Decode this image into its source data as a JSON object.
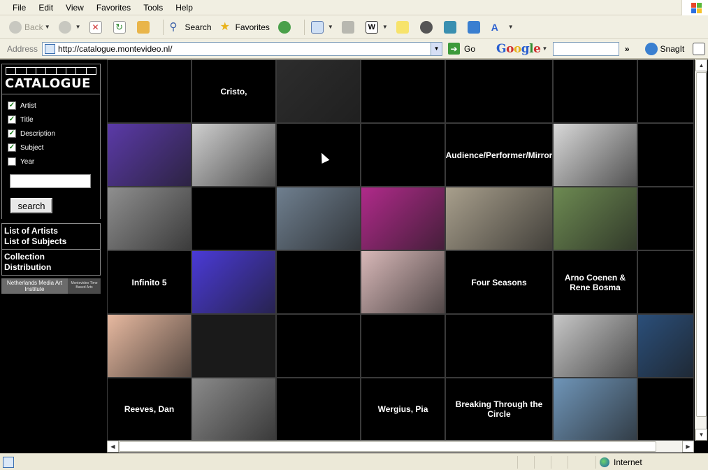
{
  "menu": [
    "File",
    "Edit",
    "View",
    "Favorites",
    "Tools",
    "Help"
  ],
  "toolbar": {
    "back_label": "Back",
    "search_label": "Search",
    "favorites_label": "Favorites"
  },
  "address": {
    "label": "Address",
    "url": "http://catalogue.montevideo.nl/",
    "go_label": "Go"
  },
  "google": {
    "logo": "Google",
    "snagit_label": "SnagIt"
  },
  "sidebar": {
    "logo_text": "CATALOGUE",
    "filters": [
      {
        "label": "Artist",
        "checked": true
      },
      {
        "label": "Title",
        "checked": true
      },
      {
        "label": "Description",
        "checked": true
      },
      {
        "label": "Subject",
        "checked": true
      },
      {
        "label": "Year",
        "checked": false
      }
    ],
    "search_button": "search",
    "links1": [
      "List of Artists",
      "List of Subjects"
    ],
    "links2": [
      "Collection",
      "Distribution"
    ],
    "partner1": "Netherlands Media Art Institute",
    "partner2": "Montevideo Time Based Arts"
  },
  "grid": {
    "cells": [
      {
        "row": 0,
        "col": 0,
        "text": "",
        "color": "#000000"
      },
      {
        "row": 0,
        "col": 1,
        "text": "Cristo,",
        "color": "#000000"
      },
      {
        "row": 0,
        "col": 2,
        "text": "",
        "color": "#2d2d2d",
        "image": true
      },
      {
        "row": 0,
        "col": 3,
        "text": "",
        "color": "#000000"
      },
      {
        "row": 0,
        "col": 4,
        "text": "",
        "color": "#000000"
      },
      {
        "row": 0,
        "col": 5,
        "text": "",
        "color": "#000000"
      },
      {
        "row": 0,
        "col": 6,
        "text": "",
        "color": "#000000"
      },
      {
        "row": 1,
        "col": 0,
        "text": "",
        "color": "#5b3aa8",
        "image": true
      },
      {
        "row": 1,
        "col": 1,
        "text": "",
        "color": "#cfcfcf",
        "image": true
      },
      {
        "row": 1,
        "col": 2,
        "text": "",
        "color": "#000000"
      },
      {
        "row": 1,
        "col": 3,
        "text": "",
        "color": "#000000"
      },
      {
        "row": 1,
        "col": 4,
        "text": "Audience/Performer/Mirror",
        "color": "#000000"
      },
      {
        "row": 1,
        "col": 5,
        "text": "",
        "color": "#d9d9d9",
        "image": true
      },
      {
        "row": 1,
        "col": 6,
        "text": "",
        "color": "#000000"
      },
      {
        "row": 2,
        "col": 0,
        "text": "",
        "color": "#8f8f8f",
        "image": true
      },
      {
        "row": 2,
        "col": 1,
        "text": "",
        "color": "#000000"
      },
      {
        "row": 2,
        "col": 2,
        "text": "",
        "color": "#6f7f8f",
        "image": true
      },
      {
        "row": 2,
        "col": 3,
        "text": "",
        "color": "#b02a8a",
        "image": true
      },
      {
        "row": 2,
        "col": 4,
        "text": "",
        "color": "#a89f8c",
        "image": true
      },
      {
        "row": 2,
        "col": 5,
        "text": "",
        "color": "#6d8a52",
        "image": true
      },
      {
        "row": 2,
        "col": 6,
        "text": "",
        "color": "#000000"
      },
      {
        "row": 3,
        "col": 0,
        "text": "Infinito 5",
        "color": "#000000"
      },
      {
        "row": 3,
        "col": 1,
        "text": "",
        "color": "#4a3ad6",
        "image": true
      },
      {
        "row": 3,
        "col": 2,
        "text": "",
        "color": "#000000"
      },
      {
        "row": 3,
        "col": 3,
        "text": "",
        "color": "#d8b8b8",
        "image": true
      },
      {
        "row": 3,
        "col": 4,
        "text": "Four Seasons",
        "color": "#000000"
      },
      {
        "row": 3,
        "col": 5,
        "text": "Arno Coenen & Rene Bosma",
        "color": "#000000"
      },
      {
        "row": 3,
        "col": 6,
        "text": "",
        "color": "#000000"
      },
      {
        "row": 4,
        "col": 0,
        "text": "",
        "color": "#e7b9a0",
        "image": true
      },
      {
        "row": 4,
        "col": 1,
        "text": "",
        "color": "#1a1a1a",
        "image": true
      },
      {
        "row": 4,
        "col": 2,
        "text": "",
        "color": "#000000"
      },
      {
        "row": 4,
        "col": 3,
        "text": "",
        "color": "#000000"
      },
      {
        "row": 4,
        "col": 4,
        "text": "",
        "color": "#000000"
      },
      {
        "row": 4,
        "col": 5,
        "text": "",
        "color": "#c7c7c7",
        "image": true
      },
      {
        "row": 4,
        "col": 6,
        "text": "",
        "color": "#2b4f7a",
        "image": true
      },
      {
        "row": 5,
        "col": 0,
        "text": "Reeves, Dan",
        "color": "#000000"
      },
      {
        "row": 5,
        "col": 1,
        "text": "",
        "color": "#8a8a8a",
        "image": true
      },
      {
        "row": 5,
        "col": 2,
        "text": "",
        "color": "#000000"
      },
      {
        "row": 5,
        "col": 3,
        "text": "Wergius, Pia",
        "color": "#000000"
      },
      {
        "row": 5,
        "col": 4,
        "text": "Breaking Through the Circle",
        "color": "#000000"
      },
      {
        "row": 5,
        "col": 5,
        "text": "",
        "color": "#6f95b8",
        "image": true
      },
      {
        "row": 5,
        "col": 6,
        "text": "",
        "color": "#000000"
      }
    ]
  },
  "status": {
    "zone": "Internet"
  }
}
